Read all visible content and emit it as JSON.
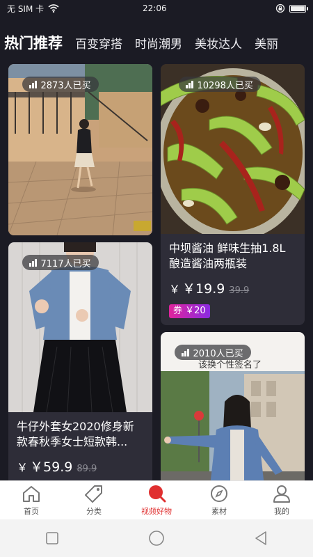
{
  "status_bar": {
    "carrier": "无 SIM 卡",
    "time": "22:06",
    "battery_level": 0.9
  },
  "tabs": [
    {
      "label": "热门推荐",
      "active": true
    },
    {
      "label": "百变穿搭",
      "active": false
    },
    {
      "label": "时尚潮男",
      "active": false
    },
    {
      "label": "美妆达人",
      "active": false
    },
    {
      "label": "美丽",
      "active": false
    }
  ],
  "feed": {
    "cards": [
      {
        "sold": "2873人已买",
        "image": "street-photo-woman-walking"
      },
      {
        "sold": "10298人已买",
        "image": "pickled-peppers-bowl",
        "title": "中坝酱油 鲜味生抽1.8L酿造酱油两瓶装",
        "currency": "￥",
        "price": "￥19.9",
        "original_price": "39.9",
        "coupon": "券 ￥20"
      },
      {
        "sold": "7117人已买",
        "image": "woman-denim-jacket",
        "title": "牛仔外套女2020修身新款春秋季女士短款韩...",
        "currency": "￥",
        "price": "￥59.9",
        "original_price": "89.9"
      },
      {
        "sold": "2010人已买",
        "image": "woman-denim-jacket-street",
        "overlay_text": "该换个性签名了"
      }
    ]
  },
  "bottom_nav": [
    {
      "label": "首页",
      "icon": "home-icon",
      "active": false
    },
    {
      "label": "分类",
      "icon": "tag-icon",
      "active": false
    },
    {
      "label": "视频好物",
      "icon": "video-goods-icon",
      "active": true
    },
    {
      "label": "素材",
      "icon": "compass-icon",
      "active": false
    },
    {
      "label": "我的",
      "icon": "user-icon",
      "active": false
    }
  ],
  "colors": {
    "background": "#1b1b24",
    "card": "#2e2d38",
    "active_tab": "#e03030",
    "coupon_start": "#e0249c",
    "coupon_end": "#8a2be2"
  }
}
